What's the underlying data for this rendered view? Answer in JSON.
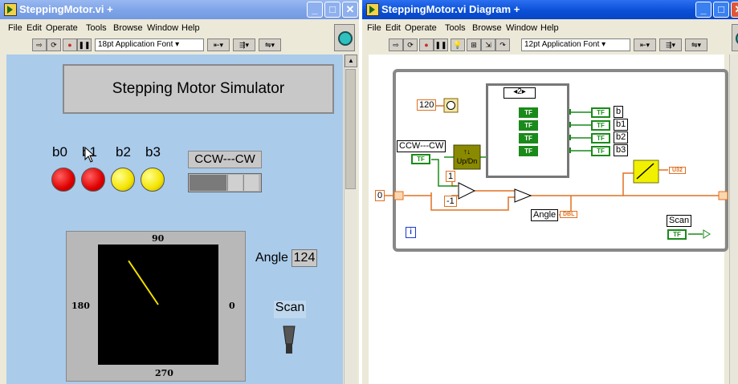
{
  "front_panel": {
    "title": "SteppingMotor.vi",
    "title_suffix": "+",
    "menus": [
      "File",
      "Edit",
      "Operate",
      "Tools",
      "Browse",
      "Window",
      "Help"
    ],
    "font_selector": "18pt Application Font",
    "heading": "Stepping Motor Simulator",
    "leds": [
      {
        "label": "b0",
        "color": "red"
      },
      {
        "label": "b1",
        "color": "red"
      },
      {
        "label": "b2",
        "color": "yellow"
      },
      {
        "label": "b3",
        "color": "yellow"
      }
    ],
    "direction_label": "CCW---CW",
    "gauge": {
      "top": "90",
      "left": "180",
      "right": "0",
      "bottom": "270",
      "needle_angle_deg": 124
    },
    "angle_label": "Angle",
    "angle_value": "124",
    "scan_label": "Scan"
  },
  "block_diagram": {
    "title": "SteppingMotor.vi Diagram",
    "title_suffix": "+",
    "menus": [
      "File",
      "Edit",
      "Operate",
      "Tools",
      "Browse",
      "Window",
      "Help"
    ],
    "font_selector": "12pt Application Font",
    "const_wait": "120",
    "ccw_cw": "CCW---CW",
    "case_selector": "2",
    "outputs": [
      "b",
      "b1",
      "b2",
      "b3"
    ],
    "const_one": "1",
    "const_neg_one": "-1",
    "shift_init": "0",
    "updn_label": "Up/Dn",
    "angle_label": "Angle",
    "angle_type": "DBL",
    "scan_label": "Scan",
    "tf": "TF",
    "iter": "i",
    "gauge_type": "U32"
  },
  "colors": {
    "panel_bg": "#aacbea",
    "led_red": "#e00000",
    "led_yellow": "#f4e400",
    "wire_orange": "#e07020",
    "wire_green": "#1a8a1a"
  }
}
